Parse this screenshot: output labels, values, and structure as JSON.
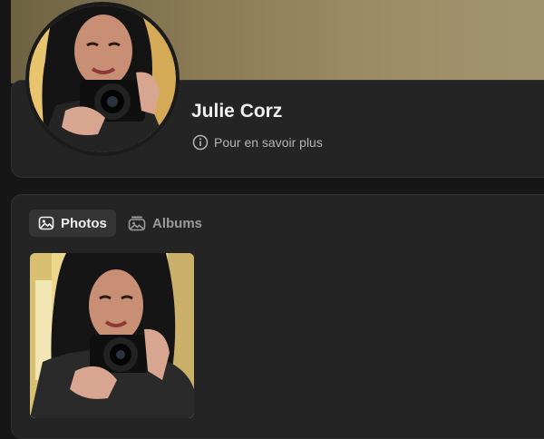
{
  "profile": {
    "name": "Julie Corz",
    "about_link": "Pour en savoir plus"
  },
  "tabs": [
    {
      "label": "Photos",
      "active": true
    },
    {
      "label": "Albums",
      "active": false
    }
  ],
  "colors": {
    "background": "#161616",
    "card": "#242424",
    "active_tab": "#343434",
    "text_primary": "#f1f1f1",
    "text_muted": "#9a9a9a"
  },
  "icons": [
    "info-icon",
    "photo-icon",
    "album-icon"
  ]
}
